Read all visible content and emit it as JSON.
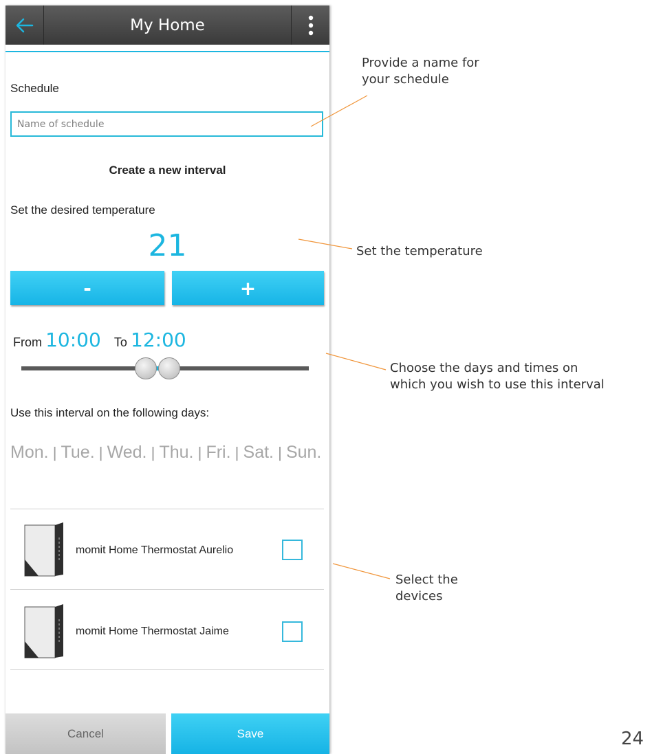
{
  "header": {
    "title": "My Home",
    "back_icon": "back-arrow-icon",
    "menu_icon": "more-vertical-icon"
  },
  "schedule": {
    "label": "Schedule",
    "placeholder": "Name of schedule"
  },
  "interval": {
    "heading": "Create a new interval",
    "temp_label": "Set the desired temperature",
    "temperature": "21",
    "minus_label": "-",
    "plus_label": "+",
    "from_label": "From",
    "from_value": "10:00",
    "to_label": "To",
    "to_value": "12:00",
    "days_label": "Use this interval on the following days:",
    "days": [
      "Mon.",
      "Tue.",
      "Wed.",
      "Thu.",
      "Fri.",
      "Sat.",
      "Sun."
    ]
  },
  "devices": [
    {
      "name": "momit Home Thermostat Aurelio",
      "checked": false
    },
    {
      "name": "momit Home Thermostat Jaime",
      "checked": false
    }
  ],
  "footer": {
    "cancel_label": "Cancel",
    "save_label": "Save"
  },
  "annotations": {
    "name": [
      "Provide a name for",
      "your schedule"
    ],
    "temperature": [
      "Set the temperature"
    ],
    "days": [
      "Choose the days and times on",
      "which you wish to use this interval"
    ],
    "devices": [
      "Select the",
      "devices"
    ]
  },
  "page_number": "24",
  "colors": {
    "accent": "#1cb6e0",
    "header": "#4a4a4a",
    "annotation_line": "#f0953a"
  }
}
